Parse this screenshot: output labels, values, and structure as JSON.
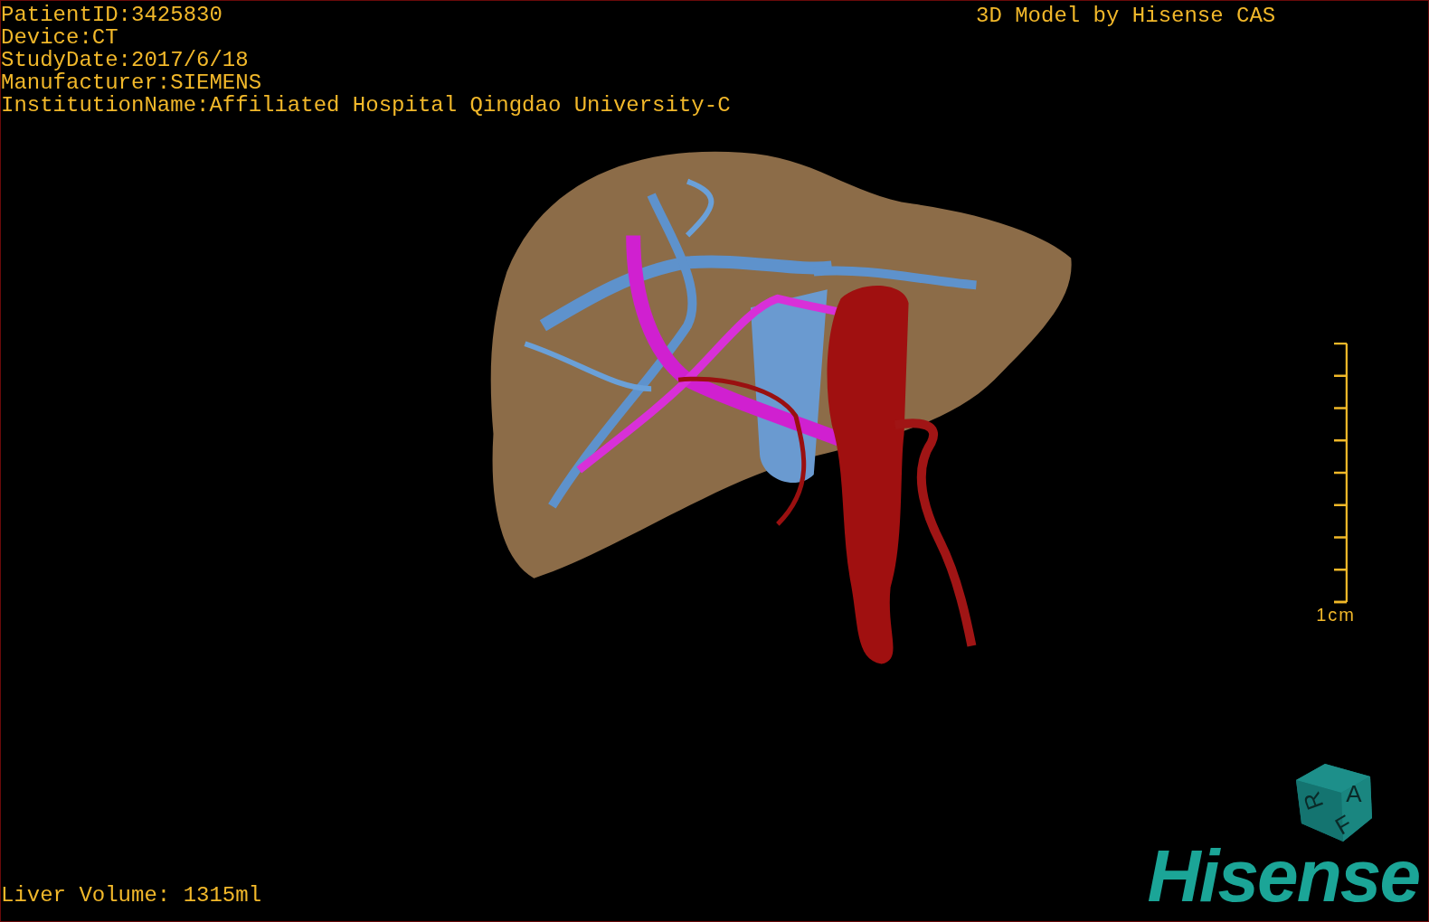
{
  "patient_info": {
    "lines": [
      "PatientID:3425830",
      "Device:CT",
      "StudyDate:2017/6/18",
      "Manufacturer:SIEMENS",
      "InstitutionName:Affiliated Hospital Qingdao University-C"
    ]
  },
  "title": "3D Model by Hisense CAS",
  "scale_bar": {
    "label": "1cm"
  },
  "orientation_cube": {
    "faces": [
      "A",
      "R",
      "F"
    ]
  },
  "logo": "Hisense",
  "liver_volume": "Liver Volume: 1315ml"
}
